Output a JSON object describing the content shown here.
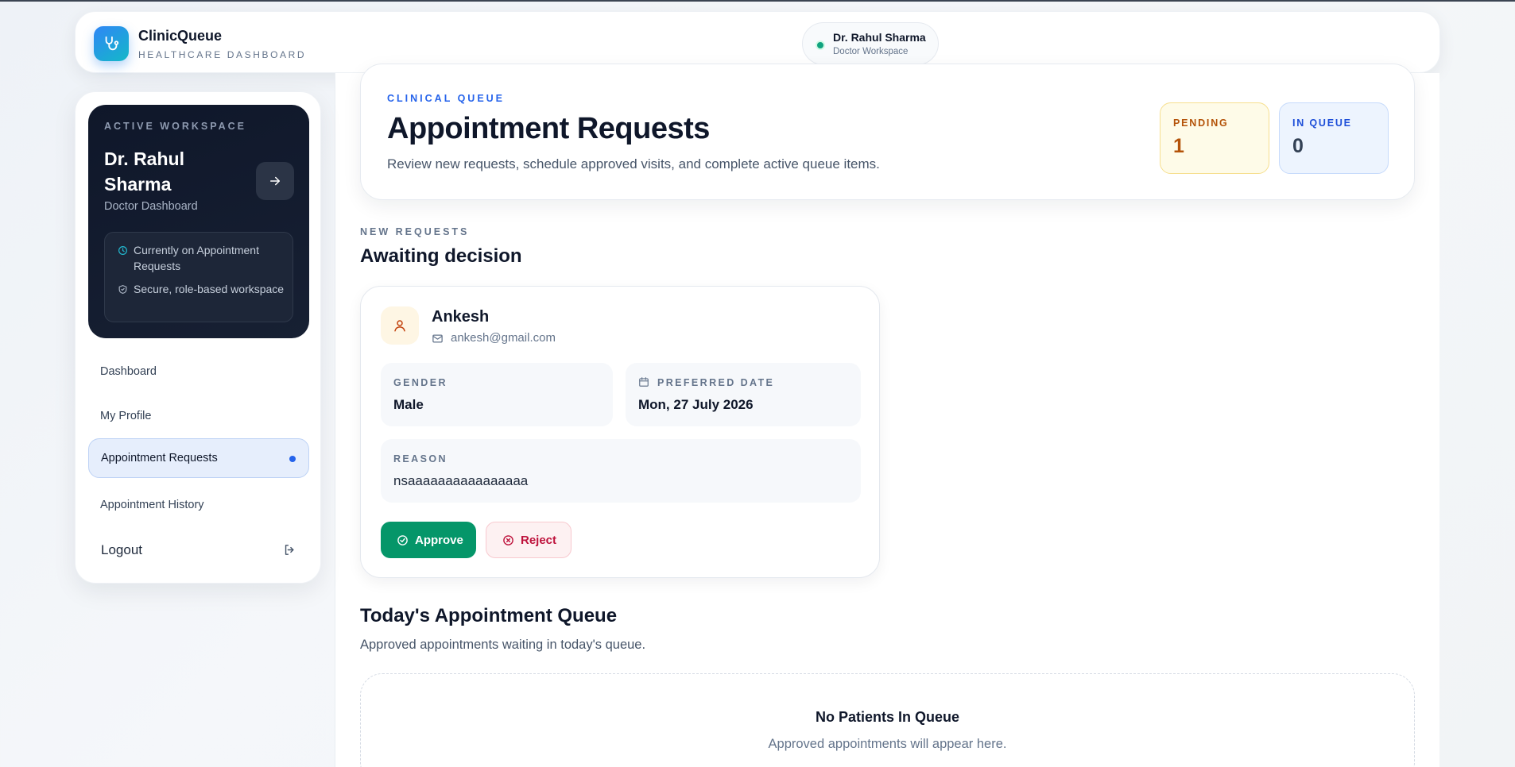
{
  "header": {
    "brand_name": "ClinicQueue",
    "brand_sub": "HEALTHCARE DASHBOARD",
    "user_name": "Dr. Rahul Sharma",
    "user_role": "Doctor Workspace",
    "status_color": "#10a37f"
  },
  "sidebar": {
    "workspace": {
      "kicker": "ACTIVE WORKSPACE",
      "name": "Dr. Rahul Sharma",
      "role": "Doctor Dashboard",
      "info": [
        "Currently on Appointment Requests",
        "Secure, role-based workspace"
      ]
    },
    "nav": [
      {
        "label": "Dashboard",
        "active": false
      },
      {
        "label": "My Profile",
        "active": false
      },
      {
        "label": "Appointment Requests",
        "active": true
      },
      {
        "label": "Appointment History",
        "active": false
      }
    ],
    "logout_label": "Logout"
  },
  "page": {
    "kicker": "CLINICAL QUEUE",
    "title": "Appointment Requests",
    "description": "Review new requests, schedule approved visits, and complete active queue items.",
    "stats": {
      "pending_label": "PENDING",
      "pending_value": "1",
      "queue_label": "IN QUEUE",
      "queue_value": "0"
    }
  },
  "requests": {
    "kicker": "NEW REQUESTS",
    "title": "Awaiting decision",
    "items": [
      {
        "name": "Ankesh",
        "email": "ankesh@gmail.com",
        "gender_label": "GENDER",
        "gender": "Male",
        "date_label": "PREFERRED DATE",
        "date": "Mon, 27 July 2026",
        "reason_label": "REASON",
        "reason": "nsaaaaaaaaaaaaaaaa",
        "approve_label": "Approve",
        "reject_label": "Reject"
      }
    ]
  },
  "queue": {
    "title": "Today's Appointment Queue",
    "description": "Approved appointments waiting in today's queue.",
    "empty_title": "No Patients In Queue",
    "empty_desc": "Approved appointments will appear here."
  },
  "colors": {
    "accent": "#2563eb",
    "approve": "#059669",
    "reject": "#be123c",
    "pending": "#b45309"
  }
}
